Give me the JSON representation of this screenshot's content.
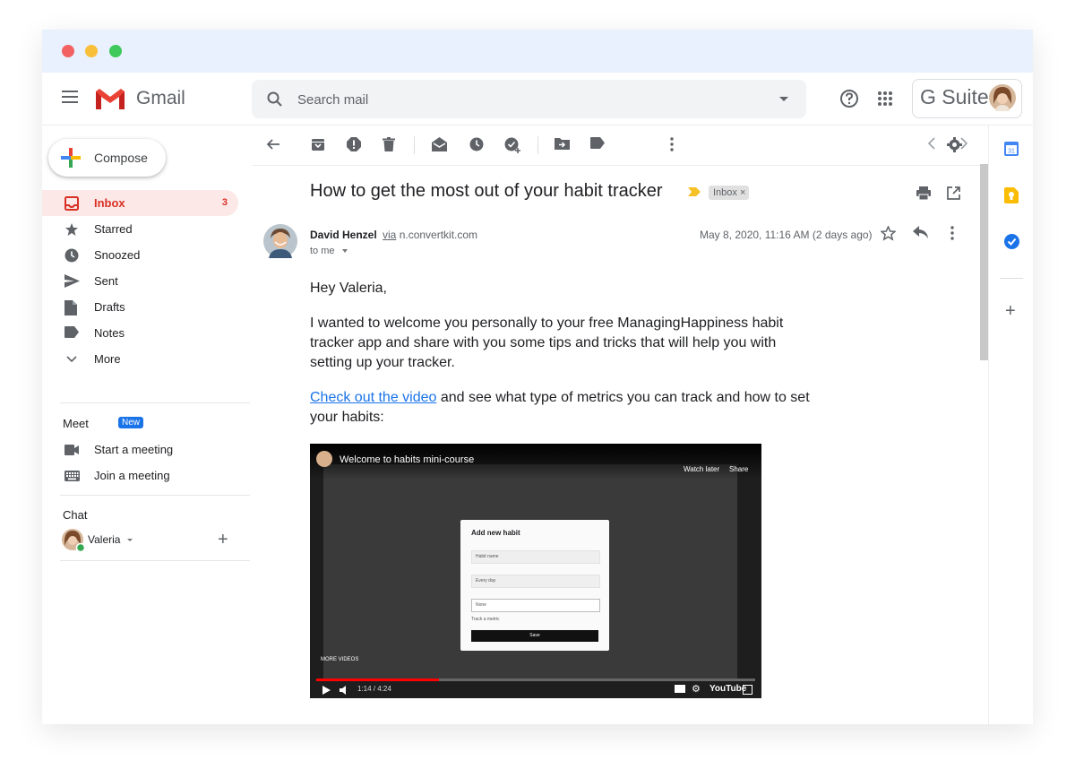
{
  "app": {
    "name": "Gmail",
    "suite_label": "G Suite"
  },
  "search": {
    "placeholder": "Search mail"
  },
  "compose": {
    "label": "Compose"
  },
  "nav": [
    {
      "label": "Inbox",
      "count": "3",
      "icon": "inbox-icon",
      "active": true
    },
    {
      "label": "Starred",
      "icon": "star-icon"
    },
    {
      "label": "Snoozed",
      "icon": "clock-icon"
    },
    {
      "label": "Sent",
      "icon": "send-icon"
    },
    {
      "label": "Drafts",
      "icon": "draft-icon"
    },
    {
      "label": "Notes",
      "icon": "label-icon"
    },
    {
      "label": "More",
      "icon": "chevron-down-icon"
    }
  ],
  "meet": {
    "title": "Meet",
    "badge": "New",
    "items": [
      {
        "label": "Start a meeting",
        "icon": "video-icon"
      },
      {
        "label": "Join a meeting",
        "icon": "keyboard-icon"
      }
    ]
  },
  "chat": {
    "title": "Chat",
    "user": "Valeria"
  },
  "email": {
    "subject": "How to get the most out of your habit tracker",
    "label_chip": "Inbox ×",
    "sender_name": "David Henzel",
    "via_word": "via",
    "via_domain": "n.convertkit.com",
    "recipient": "to me",
    "date": "May 8, 2020, 11:16 AM (2 days ago)",
    "greeting": "Hey Valeria,",
    "paragraph1": "I wanted to welcome you personally to your free ManagingHappiness habit tracker app and share with you some tips and tricks that will help you with setting up your tracker.",
    "link_text": "Check out the video",
    "paragraph2_rest": " and see what type of metrics you can track and how to set your habits:"
  },
  "video": {
    "title": "Welcome to habits mini-course",
    "watch_later": "Watch later",
    "share": "Share",
    "modal_title": "Add new habit",
    "field_name_placeholder": "Habit name",
    "field_repeat": "Every day",
    "field_group": "None",
    "track_metric": "Track a metric",
    "save": "Save",
    "more_videos": "MORE VIDEOS",
    "time": "1:14 / 4:24",
    "progress_fraction": 0.28,
    "brand": "YouTube"
  },
  "colors": {
    "accent_red": "#d93025",
    "active_bg": "#fce8e6",
    "link_blue": "#1a73e8",
    "titlebar": "#e8f1fd"
  }
}
